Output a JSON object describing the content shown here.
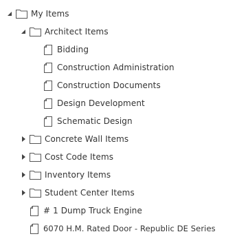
{
  "tree": {
    "root": {
      "label": "My Items",
      "expanded": true,
      "icon": "folder-icon",
      "children": {
        "architect": {
          "label": "Architect Items",
          "expanded": true,
          "icon": "folder-icon",
          "files": [
            {
              "label": "Bidding",
              "icon": "file-icon"
            },
            {
              "label": "Construction Administration",
              "icon": "file-icon"
            },
            {
              "label": "Construction Documents",
              "icon": "file-icon"
            },
            {
              "label": "Design Development",
              "icon": "file-icon"
            },
            {
              "label": "Schematic Design",
              "icon": "file-icon"
            }
          ]
        },
        "folders": [
          {
            "label": "Concrete Wall Items",
            "expanded": false,
            "icon": "folder-icon"
          },
          {
            "label": "Cost Code Items",
            "expanded": false,
            "icon": "folder-icon"
          },
          {
            "label": "Inventory Items",
            "expanded": false,
            "icon": "folder-icon"
          },
          {
            "label": "Student Center Items",
            "expanded": false,
            "icon": "folder-icon"
          }
        ],
        "files": [
          {
            "label": "# 1 Dump Truck Engine",
            "icon": "file-icon"
          },
          {
            "label": "6070 H.M. Rated Door - Republic DE Series",
            "icon": "file-icon"
          }
        ]
      }
    }
  },
  "colors": {
    "text": "#333333",
    "icon_stroke": "#555555",
    "arrow": "#444444",
    "background": "#ffffff"
  }
}
